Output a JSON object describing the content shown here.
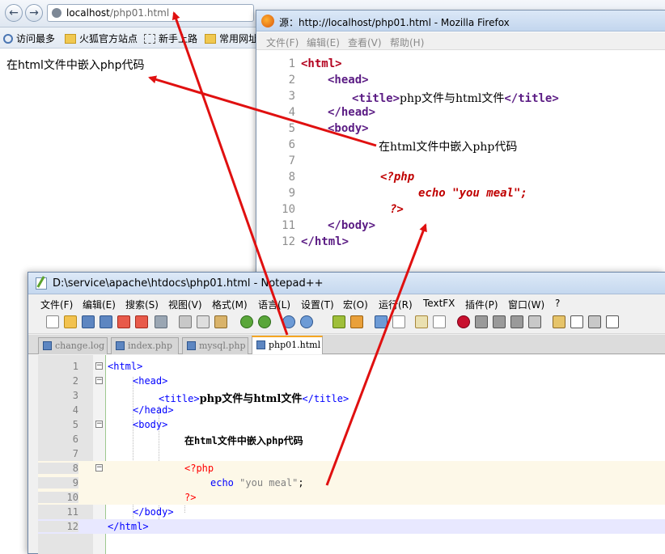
{
  "browser": {
    "url_host": "localhost",
    "url_path": "/php01.html",
    "back_glyph": "←",
    "forward_glyph": "→",
    "go_glyph": "+",
    "bookmarks": [
      "访问最多",
      "火狐官方站点",
      "新手上路",
      "常用网址"
    ],
    "page_text": "在html文件中嵌入php代码"
  },
  "source_window": {
    "title": "源：http://localhost/php01.html - Mozilla Firefox",
    "menu": [
      "文件(F)",
      "编辑(E)",
      "查看(V)",
      "帮助(H)"
    ],
    "lines": [
      {
        "n": "1",
        "text": "<html>"
      },
      {
        "n": "2",
        "text": "<head>"
      },
      {
        "n": "3",
        "open": "<title>",
        "inner": "php文件与html文件",
        "close": "</title>"
      },
      {
        "n": "4",
        "text": "</head>"
      },
      {
        "n": "5",
        "text": "<body>"
      },
      {
        "n": "6",
        "text": "在html文件中嵌入php代码"
      },
      {
        "n": "7",
        "text": ""
      },
      {
        "n": "8",
        "text": "<?php"
      },
      {
        "n": "9",
        "text": "echo \"you meal\";"
      },
      {
        "n": "10",
        "text": "?>"
      },
      {
        "n": "11",
        "text": "</body>"
      },
      {
        "n": "12",
        "text": "</html>"
      }
    ]
  },
  "notepad": {
    "title": "D:\\service\\apache\\htdocs\\php01.html - Notepad++",
    "menu": [
      "文件(F)",
      "编辑(E)",
      "搜索(S)",
      "视图(V)",
      "格式(M)",
      "语言(L)",
      "设置(T)",
      "宏(O)",
      "运行(R)",
      "TextFX",
      "插件(P)",
      "窗口(W)",
      "?"
    ],
    "tabs": [
      "change.log",
      "index.php",
      "mysql.php",
      "php01.html"
    ],
    "active_tab": "php01.html",
    "lines": [
      {
        "n": "1",
        "text": "<html>"
      },
      {
        "n": "2",
        "text": "<head>"
      },
      {
        "n": "3",
        "open": "<title>",
        "inner": "php文件与html文件",
        "close": "</title>"
      },
      {
        "n": "4",
        "text": "</head>"
      },
      {
        "n": "5",
        "text": "<body>"
      },
      {
        "n": "6",
        "text": "在html文件中嵌入php代码"
      },
      {
        "n": "7",
        "text": ""
      },
      {
        "n": "8",
        "text": "<?php"
      },
      {
        "n": "9",
        "kw": "echo",
        "str": "\"you meal\"",
        "end": ";"
      },
      {
        "n": "10",
        "text": "?>"
      },
      {
        "n": "11",
        "text": "</body>"
      },
      {
        "n": "12",
        "text": "</html>"
      }
    ]
  },
  "colors": {
    "annotation_arrow": "#e01010",
    "npp_tag": "#0000ff",
    "npp_php": "#ff0000",
    "source_tag": "#5b1c84",
    "source_php": "#c00000"
  }
}
